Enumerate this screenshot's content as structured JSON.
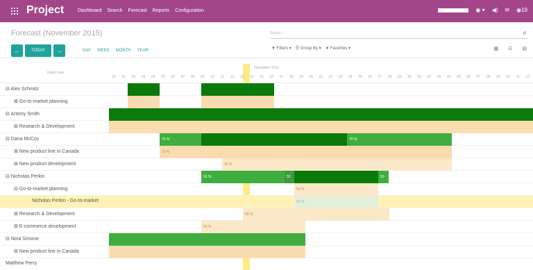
{
  "topbar": {
    "brand": "Project",
    "menu": [
      "Dashboard",
      "Search",
      "Forecast",
      "Reports",
      "Configuration"
    ],
    "right": [
      "◉ ▾",
      "◀)",
      "✉",
      "◉19"
    ]
  },
  "control_panel": {
    "title": "Forecast (November 2015)",
    "search_placeholder": "Search...",
    "today_label": "TODAY",
    "scales": [
      "DAY",
      "WEEK",
      "MONTH",
      "YEAR"
    ],
    "filters": [
      "▼ Filters ▾",
      "☰ Group By ▾",
      "★ Favorites ▾"
    ],
    "view_icons": [
      "▦",
      "☰",
      "▤"
    ]
  },
  "gantt": {
    "header_left": "Gantt View",
    "month": "November 2015",
    "days": [
      "31",
      "01",
      "02",
      "03",
      "04",
      "05",
      "06",
      "07",
      "08",
      "09",
      "10",
      "11",
      "12",
      "13",
      "14",
      "15",
      "16",
      "17",
      "18",
      "19",
      "20",
      "21",
      "22",
      "23",
      "24",
      "25",
      "26",
      "27",
      "28",
      "29",
      "30",
      "01",
      "02",
      "03",
      "04",
      "05",
      "06",
      "07",
      "08",
      "09",
      "10",
      "11",
      "12"
    ],
    "rows": [
      {
        "label": "⊟ Alex Schmitz",
        "level": 0
      },
      {
        "label": "⊞ Go-to-market planning",
        "level": 1
      },
      {
        "label": "⊟ Antony Smith",
        "level": 0
      },
      {
        "label": "⊞ Research & Development",
        "level": 1
      },
      {
        "label": "⊟ Dana McCoy",
        "level": 0
      },
      {
        "label": "⊞ New product line in Canada",
        "level": 1
      },
      {
        "label": "⊞ New product development",
        "level": 1
      },
      {
        "label": "⊟ Nicholas Perkin",
        "level": 0
      },
      {
        "label": "⊟ Go-to-market planning",
        "level": 1
      },
      {
        "label": "Nicholas Perkin - Go-to-market",
        "level": 2
      },
      {
        "label": "⊞ Research & Development",
        "level": 1
      },
      {
        "label": "⊞ E-commerce development",
        "level": 1
      },
      {
        "label": "⊟ Nina Simone",
        "level": 0
      },
      {
        "label": "⊞ New product line in Canada",
        "level": 1
      },
      {
        "label": "Matthew Perry",
        "level": 0
      }
    ],
    "bar_labels": {
      "dana_a": "70 %",
      "dana_b": "70 %",
      "dana_canada": "70 %",
      "dana_dev": "30 %",
      "nick_a": "50 %",
      "nick_b": "50",
      "nick_c": "50",
      "nick_gtm": "50 %",
      "nick_task": "50 %",
      "nick_rd": "50 %",
      "nick_ecom": "50 %"
    }
  },
  "colors": {
    "topbar": "#a24689",
    "accent": "#1fa39c",
    "bar_dark": "#0a7a0a",
    "bar_light": "#3fae3f",
    "bar_pale": "#f9dcb0",
    "today": "#fde870"
  }
}
